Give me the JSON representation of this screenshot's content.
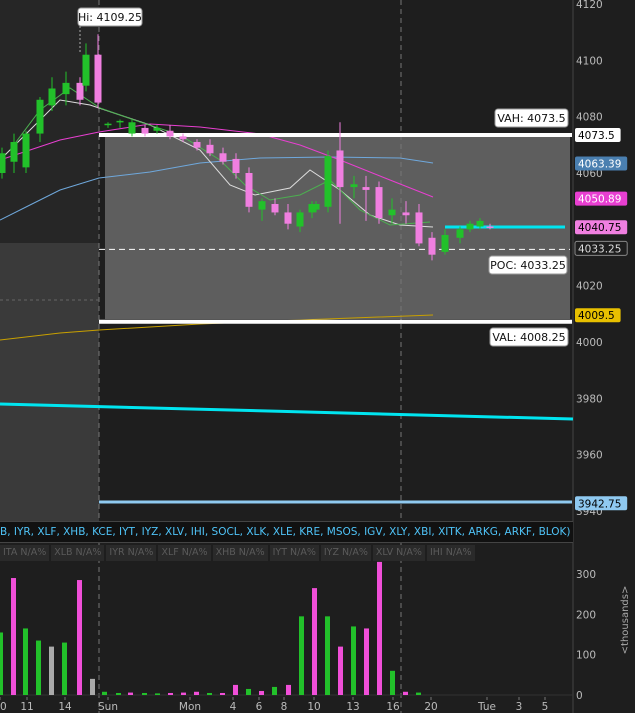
{
  "price_panel": {
    "hi_label": "Hi: 4109.25",
    "vah_label": "VAH: 4073.5",
    "poc_label": "POC: 4033.25",
    "val_label": "VAL: 4008.25",
    "markers": [
      {
        "value": 4073.5,
        "text": "4073.5",
        "bg": "#ffffff",
        "fg": "#000000"
      },
      {
        "value": 4063.39,
        "text": "4063.39",
        "bg": "#4a7fb0",
        "fg": "#ffffff"
      },
      {
        "value": 4050.89,
        "text": "4050.89",
        "bg": "#e83fd1",
        "fg": "#ffffff"
      },
      {
        "value": 4040.75,
        "text": "4040.75",
        "bg": "#f07fe0",
        "fg": "#000000"
      },
      {
        "value": 4033.25,
        "text": "4033.25",
        "bg": "#1e1e1e",
        "fg": "#dddddd"
      },
      {
        "value": 4009.5,
        "text": "4009.5",
        "bg": "#e8c000",
        "fg": "#000000"
      },
      {
        "value": 3942.75,
        "text": "3942.75",
        "bg": "#8fc9f0",
        "fg": "#000000"
      }
    ]
  },
  "watchlist_text": "B, IYR, XLF, XHB, KCE, IYT, IYZ, XLV, IHI, SOCL, XLK, XLE, KRE, MSOS, IGV, XLY, XBI, XITK, ARKG, ARKF, BLOK)",
  "study_badges": [
    "ITA N/A%",
    "XLB N/A%",
    "IYR N/A%",
    "XLF N/A%",
    "XHB N/A%",
    "IYT N/A%",
    "IYZ N/A%",
    "XLV N/A%",
    "IHI N/A%"
  ],
  "chart_data": [
    {
      "type": "candlestick",
      "y_ticks": [
        "4120",
        "4100",
        "4080",
        "4060",
        "4040",
        "4020",
        "4000",
        "3980",
        "3960",
        "3940"
      ],
      "ylim": [
        3938,
        4122
      ],
      "x_ticks": [
        "0",
        "11",
        "14",
        "Sun",
        "Mon",
        "4",
        "6",
        "8",
        "10",
        "13",
        "16",
        "20",
        "Tue",
        "3",
        "5"
      ],
      "candles": [
        {
          "o": 4060,
          "h": 4069,
          "l": 4058,
          "c": 4067
        },
        {
          "o": 4064,
          "h": 4074,
          "l": 4060,
          "c": 4071
        },
        {
          "o": 4062,
          "h": 4075,
          "l": 4060,
          "c": 4074
        },
        {
          "o": 4074,
          "h": 4087,
          "l": 4071,
          "c": 4086
        },
        {
          "o": 4084,
          "h": 4094,
          "l": 4082,
          "c": 4090
        },
        {
          "o": 4088,
          "h": 4096,
          "l": 4084,
          "c": 4092
        },
        {
          "o": 4092,
          "h": 4094,
          "l": 4084,
          "c": 4086
        },
        {
          "o": 4091,
          "h": 4106,
          "l": 4089,
          "c": 4102
        },
        {
          "o": 4102,
          "h": 4109.25,
          "l": 4083,
          "c": 4085
        },
        {
          "o": 4077,
          "h": 4078,
          "l": 4076,
          "c": 4077.5
        },
        {
          "o": 4078,
          "h": 4079,
          "l": 4076,
          "c": 4078.5
        },
        {
          "o": 4074,
          "h": 4079,
          "l": 4073,
          "c": 4078
        },
        {
          "o": 4076,
          "h": 4077,
          "l": 4073,
          "c": 4074
        },
        {
          "o": 4075,
          "h": 4077,
          "l": 4074,
          "c": 4076
        },
        {
          "o": 4075,
          "h": 4077,
          "l": 4072,
          "c": 4073
        },
        {
          "o": 4073,
          "h": 4074,
          "l": 4071,
          "c": 4072
        },
        {
          "o": 4071,
          "h": 4072,
          "l": 4068,
          "c": 4069
        },
        {
          "o": 4070,
          "h": 4072,
          "l": 4066,
          "c": 4067
        },
        {
          "o": 4067,
          "h": 4069,
          "l": 4063,
          "c": 4064
        },
        {
          "o": 4065,
          "h": 4067,
          "l": 4058,
          "c": 4060
        },
        {
          "o": 4060,
          "h": 4062,
          "l": 4046,
          "c": 4048
        },
        {
          "o": 4047,
          "h": 4051,
          "l": 4043,
          "c": 4050
        },
        {
          "o": 4049,
          "h": 4051,
          "l": 4045,
          "c": 4046
        },
        {
          "o": 4046,
          "h": 4049,
          "l": 4040,
          "c": 4042
        },
        {
          "o": 4041,
          "h": 4047,
          "l": 4039,
          "c": 4046
        },
        {
          "o": 4046,
          "h": 4050,
          "l": 4044,
          "c": 4049
        },
        {
          "o": 4047,
          "h": 4050,
          "l": 4046,
          "c": 4049
        },
        {
          "o": 4048,
          "h": 4068,
          "l": 4046,
          "c": 4066
        },
        {
          "o": 4068,
          "h": 4078,
          "l": 4042,
          "c": 4055
        },
        {
          "o": 4055,
          "h": 4059,
          "l": 4051,
          "c": 4056
        },
        {
          "o": 4055,
          "h": 4059,
          "l": 4043,
          "c": 4054
        },
        {
          "o": 4055,
          "h": 4057,
          "l": 4042,
          "c": 4044
        },
        {
          "o": 4045,
          "h": 4051,
          "l": 4042,
          "c": 4047
        },
        {
          "o": 4046,
          "h": 4050,
          "l": 4042,
          "c": 4045
        },
        {
          "o": 4046,
          "h": 4049,
          "l": 4034,
          "c": 4035
        },
        {
          "o": 4037,
          "h": 4039,
          "l": 4029,
          "c": 4031
        },
        {
          "o": 4032,
          "h": 4040,
          "l": 4031,
          "c": 4038
        },
        {
          "o": 4037,
          "h": 4041,
          "l": 4035,
          "c": 4040
        },
        {
          "o": 4040,
          "h": 4043,
          "l": 4039,
          "c": 4042
        },
        {
          "o": 4041,
          "h": 4044,
          "l": 4040,
          "c": 4043
        },
        {
          "o": 4041,
          "h": 4042,
          "l": 4040,
          "c": 4040.5
        }
      ],
      "volume": {
        "y_ticks": [
          "300",
          "200",
          "100",
          "0"
        ],
        "unit_label": "<thousands>",
        "bars": [
          {
            "v": 155,
            "color": "#22c12a"
          },
          {
            "v": 290,
            "color": "#f04fd8"
          },
          {
            "v": 165,
            "color": "#22c12a"
          },
          {
            "v": 135,
            "color": "#22c12a"
          },
          {
            "v": 120,
            "color": "#aaaaaa"
          },
          {
            "v": 130,
            "color": "#22c12a"
          },
          {
            "v": 285,
            "color": "#f04fd8"
          },
          {
            "v": 40,
            "color": "#aaaaaa"
          },
          {
            "v": 8,
            "color": "#22c12a"
          },
          {
            "v": 5,
            "color": "#22c12a"
          },
          {
            "v": 6,
            "color": "#f04fd8"
          },
          {
            "v": 5,
            "color": "#22c12a"
          },
          {
            "v": 4,
            "color": "#22c12a"
          },
          {
            "v": 5,
            "color": "#f04fd8"
          },
          {
            "v": 6,
            "color": "#f04fd8"
          },
          {
            "v": 8,
            "color": "#f04fd8"
          },
          {
            "v": 5,
            "color": "#22c12a"
          },
          {
            "v": 5,
            "color": "#f04fd8"
          },
          {
            "v": 25,
            "color": "#f04fd8"
          },
          {
            "v": 15,
            "color": "#22c12a"
          },
          {
            "v": 10,
            "color": "#f04fd8"
          },
          {
            "v": 20,
            "color": "#22c12a"
          },
          {
            "v": 25,
            "color": "#f04fd8"
          },
          {
            "v": 30,
            "color": "#22c12a"
          },
          {
            "v": 195,
            "color": "#22c12a"
          },
          {
            "v": 265,
            "color": "#f04fd8"
          },
          {
            "v": 195,
            "color": "#22c12a"
          },
          {
            "v": 120,
            "color": "#f04fd8"
          },
          {
            "v": 170,
            "color": "#22c12a"
          },
          {
            "v": 165,
            "color": "#f04fd8"
          },
          {
            "v": 330,
            "color": "#f04fd8"
          },
          {
            "v": 60,
            "color": "#22c12a"
          },
          {
            "v": 8,
            "color": "#f04fd8"
          },
          {
            "v": 6,
            "color": "#22c12a"
          }
        ]
      }
    }
  ]
}
